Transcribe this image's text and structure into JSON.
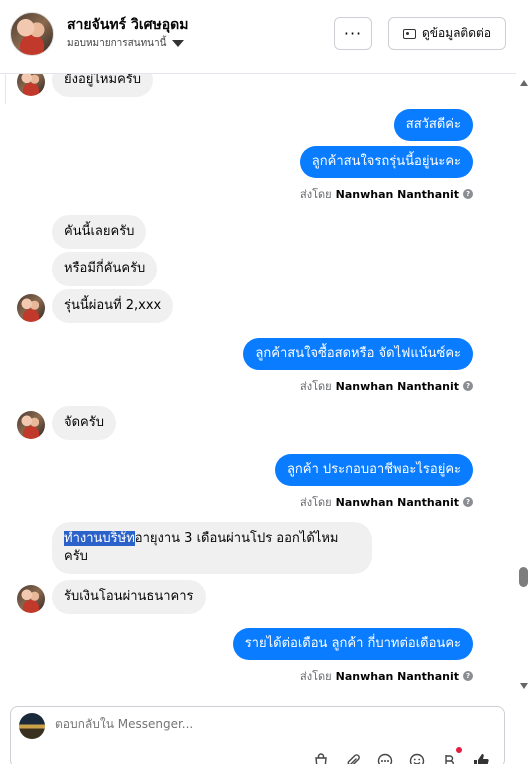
{
  "header": {
    "contact_name": "สายจันทร์ วิเศษอุดม",
    "assign_label": "มอบหมายการสนทนานี้",
    "more_label": "···",
    "info_label": "ดูข้อมูลติดต่อ"
  },
  "messages": {
    "m1": "ยังอยู่ไหมครับ",
    "m2": "สสวัสดีค่ะ",
    "m3": "ลูกค้าสนใจรถรุ่นนี้อยู่นะคะ",
    "m4": "คันนี้เลยครับ",
    "m5": "หรือมีกี่คันครับ",
    "m6": "รุ่นนี้ผ่อนที่ 2,xxx",
    "m7": "ลูกค้าสนใจซื้อสดหรือ จัดไฟแน้นซ์คะ",
    "m8": "จัดครับ",
    "m9": "ลูกค้า ประกอบอาชีพอะไรอยู่คะ",
    "m10_highlight": "ทำงานบริษัท",
    "m10_rest": "อายุงาน 3 เดือนผ่านโปร ออกได้ไหม",
    "m10_line2": "ครับ",
    "m11": "รับเงินโอนผ่านธนาคาร",
    "m12": "รายได้ต่อเดือน ลูกค้า กี่บาทต่อเดือนคะ"
  },
  "sent_by": {
    "prefix": "ส่งโดย",
    "sender": "Nanwhan Nanthanit",
    "help": "?"
  },
  "composer": {
    "placeholder": "ตอบกลับใน Messenger..."
  },
  "colors": {
    "outgoing_bubble": "#0a7cff",
    "incoming_bubble": "#f0f0f0",
    "notification_dot": "#e41e3f"
  }
}
